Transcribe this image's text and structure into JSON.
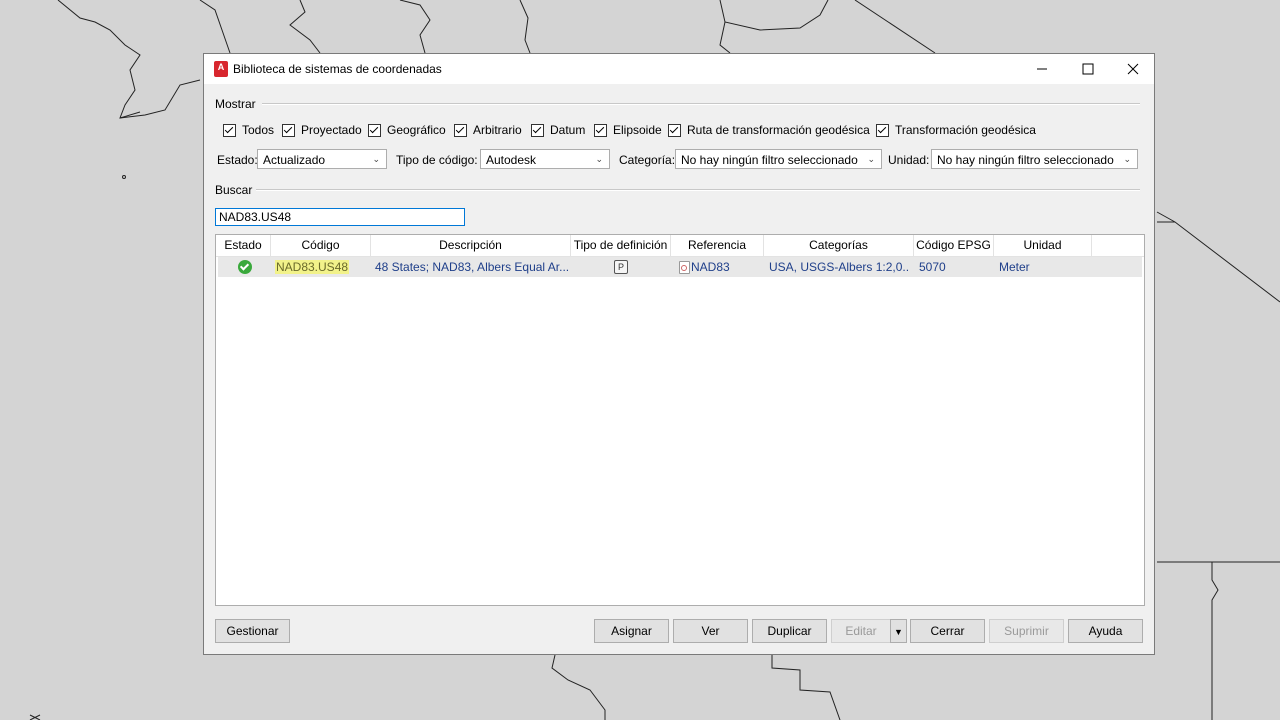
{
  "dialog": {
    "title": "Biblioteca de sistemas de coordenadas",
    "app_icon_text": "A"
  },
  "mostrar": {
    "label": "Mostrar",
    "checkboxes": [
      {
        "label": "Todos",
        "checked": true
      },
      {
        "label": "Proyectado",
        "checked": true
      },
      {
        "label": "Geográfico",
        "checked": true
      },
      {
        "label": "Arbitrario",
        "checked": true
      },
      {
        "label": "Datum",
        "checked": true
      },
      {
        "label": "Elipsoide",
        "checked": true
      },
      {
        "label": "Ruta de transformación geodésica",
        "checked": true
      },
      {
        "label": "Transformación geodésica",
        "checked": true
      }
    ]
  },
  "filters": {
    "estado_label": "Estado:",
    "estado_value": "Actualizado",
    "tipo_label": "Tipo de código:",
    "tipo_value": "Autodesk",
    "categoria_label": "Categoría:",
    "categoria_value": "No hay ningún filtro seleccionado",
    "unidad_label": "Unidad:",
    "unidad_value": "No hay ningún filtro seleccionado"
  },
  "search": {
    "label": "Buscar",
    "value": "NAD83.US48"
  },
  "table": {
    "columns": [
      "Estado",
      "Código",
      "Descripción",
      "Tipo de definición",
      "Referencia",
      "Categorías",
      "Código EPSG",
      "Unidad"
    ],
    "rows": [
      {
        "estado": "ok",
        "codigo": "NAD83.US48",
        "descripcion": "48 States; NAD83, Albers Equal Ar...",
        "tipo": "P",
        "referencia": "NAD83",
        "categorias": "USA, USGS-Albers 1:2,0...",
        "epsg": "5070",
        "unidad": "Meter"
      }
    ]
  },
  "buttons": {
    "gestionar": "Gestionar",
    "asignar": "Asignar",
    "ver": "Ver",
    "duplicar": "Duplicar",
    "editar": "Editar",
    "cerrar": "Cerrar",
    "suprimir": "Suprimir",
    "ayuda": "Ayuda"
  },
  "colors": {
    "accent": "#0078d7",
    "status_ok": "#3aa93c",
    "highlight": "#f2f28a"
  }
}
